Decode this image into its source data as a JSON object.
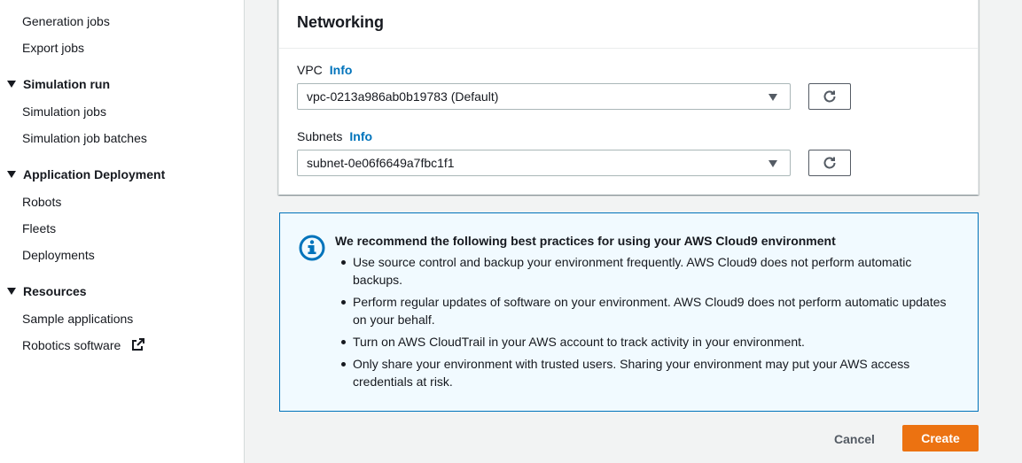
{
  "sidebar": {
    "links_top": [
      "Generation jobs",
      "Export jobs"
    ],
    "simulation_run": {
      "title": "Simulation run",
      "items": [
        "Simulation jobs",
        "Simulation job batches"
      ]
    },
    "application_deployment": {
      "title": "Application Deployment",
      "items": [
        "Robots",
        "Fleets",
        "Deployments"
      ]
    },
    "resources": {
      "title": "Resources",
      "items": [
        "Sample applications",
        "Robotics software"
      ]
    }
  },
  "networking": {
    "title": "Networking",
    "vpc_label": "VPC",
    "vpc_info": "Info",
    "vpc_value": "vpc-0213a986ab0b19783 (Default)",
    "subnets_label": "Subnets",
    "subnets_info": "Info",
    "subnet_value": "subnet-0e06f6649a7fbc1f1"
  },
  "alert": {
    "title": "We recommend the following best practices for using your AWS Cloud9 environment",
    "items": [
      "Use source control and backup your environment frequently. AWS Cloud9 does not perform automatic backups.",
      "Perform regular updates of software on your environment. AWS Cloud9 does not perform automatic updates on your behalf.",
      "Turn on AWS CloudTrail in your AWS account to track activity in your environment.",
      "Only share your environment with trusted users. Sharing your environment may put your AWS access credentials at risk."
    ]
  },
  "actions": {
    "cancel": "Cancel",
    "create": "Create"
  },
  "icons": {
    "external": "external-link-icon",
    "refresh": "refresh-icon",
    "info": "info-circle-icon"
  },
  "colors": {
    "primary_button": "#ec7211",
    "link": "#0073bb",
    "alert_bg": "#f1faff",
    "alert_border": "#0073bb"
  }
}
